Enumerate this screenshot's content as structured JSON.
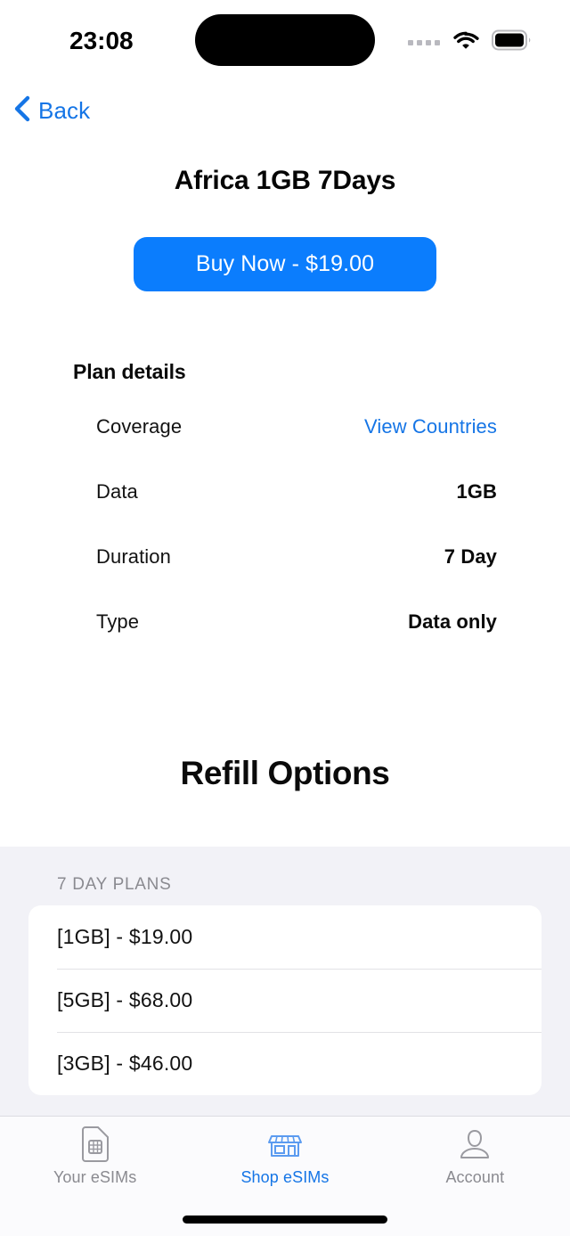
{
  "status_bar": {
    "time": "23:08",
    "signal_icon": "signal-dots-icon",
    "wifi_icon": "wifi-icon",
    "battery_icon": "battery-full-icon",
    "dynamic_island": "dynamic-island"
  },
  "nav": {
    "back_label": "Back",
    "back_icon": "chevron-left-icon"
  },
  "header": {
    "title": "Africa 1GB 7Days"
  },
  "buy": {
    "label": "Buy Now - $19.00",
    "color": "#0b7dfd"
  },
  "plan_details": {
    "heading": "Plan details",
    "rows": [
      {
        "label": "Coverage",
        "value": "View Countries",
        "is_link": true
      },
      {
        "label": "Data",
        "value": "1GB",
        "is_link": false
      },
      {
        "label": "Duration",
        "value": "7 Day",
        "is_link": false
      },
      {
        "label": "Type",
        "value": "Data only",
        "is_link": false
      }
    ]
  },
  "refill": {
    "heading": "Refill Options",
    "group_label": "7 DAY PLANS",
    "options": [
      {
        "text": "[1GB]  -  $19.00"
      },
      {
        "text": "[5GB]  -  $68.00"
      },
      {
        "text": "[3GB]  -  $46.00"
      }
    ]
  },
  "tab_bar": {
    "active_color": "#1575e6",
    "inactive_color": "#8a8a90",
    "tabs": [
      {
        "label": "Your eSIMs",
        "icon": "sim-card-icon",
        "active": false
      },
      {
        "label": "Shop eSIMs",
        "icon": "storefront-icon",
        "active": true
      },
      {
        "label": "Account",
        "icon": "person-icon",
        "active": false
      }
    ]
  }
}
